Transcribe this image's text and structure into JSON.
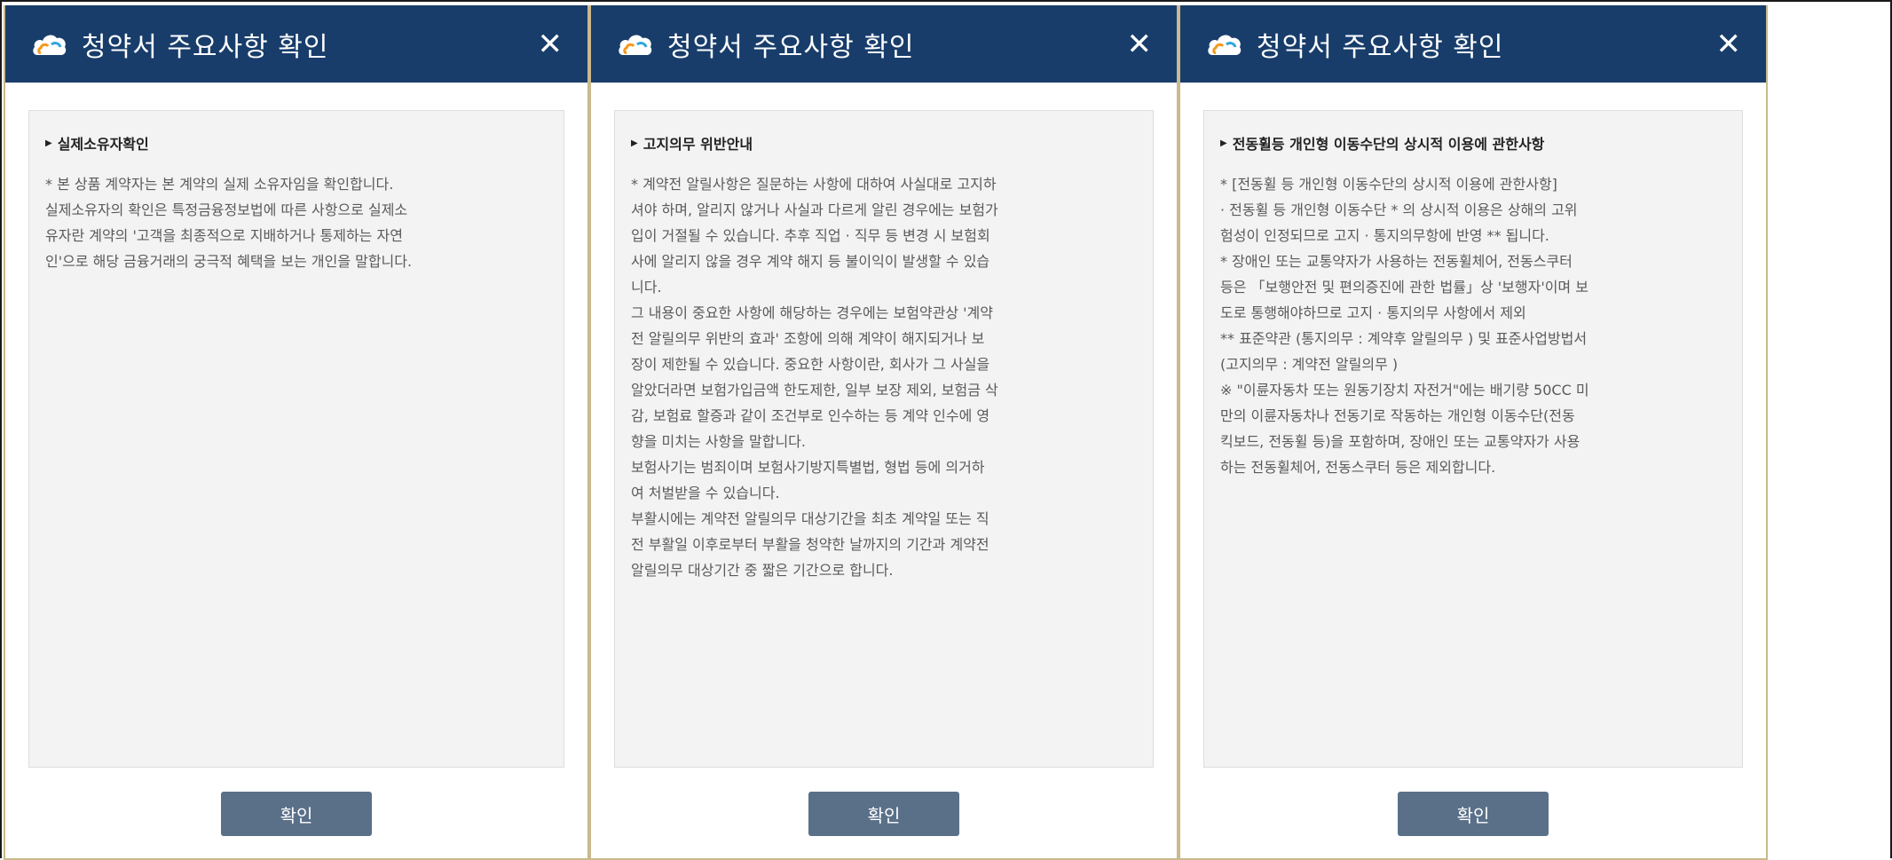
{
  "dialogs": [
    {
      "title": "청약서 주요사항 확인",
      "close_symbol": "✕",
      "section_title": "실제소유자확인",
      "body": "* 본 상품 계약자는 본 계약의 실제 소유자임을 확인합니다.\n  실제소유자의 확인은 특정금융정보법에 따른 사항으로 실제소\n  유자란 계약의 '고객을 최종적으로 지배하거나 통제하는 자연\n  인'으로 해당 금융거래의 궁극적 혜택을 보는 개인을 말합니다.",
      "confirm_label": "확인"
    },
    {
      "title": "청약서 주요사항 확인",
      "close_symbol": "✕",
      "section_title": "고지의무 위반안내",
      "body": "* 계약전 알릴사항은 질문하는 사항에 대하여 사실대로 고지하\n  셔야 하며, 알리지 않거나 사실과 다르게 알린 경우에는 보험가\n  입이 거절될 수 있습니다. 추후 직업 · 직무 등 변경 시 보험회\n  사에 알리지 않을 경우 계약 해지 등 불이익이 발생할 수 있습\n  니다.\n  그 내용이 중요한 사항에 해당하는 경우에는 보험약관상 '계약\n  전 알릴의무 위반의 효과' 조항에 의해 계약이 해지되거나 보\n  장이 제한될 수 있습니다. 중요한 사항이란, 회사가 그 사실을\n  알았더라면 보험가입금액 한도제한, 일부 보장 제외, 보험금 삭\n  감, 보험료 할증과 같이 조건부로 인수하는 등 계약 인수에 영\n  향을 미치는 사항을 말합니다.\n  보험사기는 범죄이며 보험사기방지특별법, 형법 등에 의거하\n  여 처벌받을 수 있습니다.\n  부활시에는 계약전 알릴의무 대상기간을 최초 계약일 또는 직\n  전 부활일 이후로부터 부활을 청약한 날까지의 기간과 계약전\n  알릴의무 대상기간 중 짧은 기간으로 합니다.",
      "confirm_label": "확인"
    },
    {
      "title": "청약서 주요사항 확인",
      "close_symbol": "✕",
      "section_title": "전동휠등 개인형 이동수단의 상시적 이용에 관한사항",
      "body": "* [전동휠 등 개인형 이동수단의 상시적 이용에 관한사항]\n   · 전동휠 등 개인형 이동수단 * 의 상시적 이용은 상해의 고위\n  험성이 인정되므로 고지 · 통지의무항에 반영 ** 됩니다.\n  * 장애인 또는 교통약자가 사용하는 전동휠체어, 전동스쿠터\n  등은 「보행안전 및 편의증진에 관한 법률」상 '보행자'이며 보\n  도로 통행해야하므로 고지 · 통지의무 사항에서 제외\n  ** 표준약관 (통지의무 : 계약후 알릴의무 ) 및 표준사업방법서\n  (고지의무 : 계약전 알릴의무 )\n  ※ \"이륜자동차 또는 원동기장치 자전거\"에는 배기량 50CC 미\n  만의 이륜자동차나 전동기로 작동하는 개인형 이동수단(전동\n  킥보드, 전동휠 등)을 포함하며, 장애인 또는 교통약자가 사용\n  하는 전동휠체어, 전동스쿠터 등은 제외합니다.",
      "confirm_label": "확인"
    }
  ],
  "colors": {
    "header_bg": "#183d6b",
    "content_bg": "#f3f3f3",
    "button_bg": "#5a7089",
    "dialog_border": "#c9b98c"
  },
  "icons": {
    "brand": "cloud-logo-icon",
    "close": "close-icon",
    "section_marker": "triangle-right-icon"
  }
}
